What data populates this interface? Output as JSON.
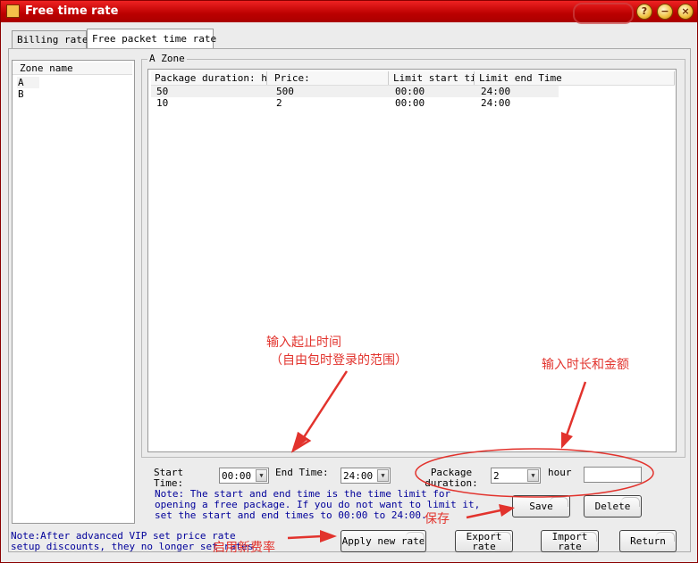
{
  "window": {
    "title": "Free time rate",
    "buttons": {
      "help": "?",
      "minimize": "−",
      "close": "×"
    }
  },
  "tabs": [
    {
      "label": "Billing rate",
      "active": false
    },
    {
      "label": "Free packet time rate",
      "active": true
    }
  ],
  "zone_list": {
    "header": "Zone name",
    "items": [
      "A",
      "B"
    ],
    "selected": "A"
  },
  "group": {
    "label": "A Zone"
  },
  "table": {
    "columns": [
      "Package duration: hour",
      "Price:",
      "Limit start time",
      "Limit end Time"
    ],
    "rows": [
      [
        "50",
        "500",
        "00:00",
        "24:00"
      ],
      [
        "10",
        "2",
        "00:00",
        "24:00"
      ]
    ]
  },
  "form": {
    "start_time_label": "Start Time:",
    "start_time_value": "00:00",
    "end_time_label": "End Time:",
    "end_time_value": "24:00",
    "package_duration_label": "Package duration:",
    "package_duration_value": "2",
    "hour_label": "hour",
    "price_value": ""
  },
  "note_time": "Note: The start and end time is the time limit for opening a free package. If you do not want to limit it, set the start and end times to 00:00 to 24:00.",
  "note_vip": "Note:After advanced VIP set price rate setup discounts, they no longer set rates.",
  "buttons": {
    "save": "Save",
    "delete": "Delete",
    "apply": "Apply new rate",
    "export": "Export rate",
    "import": "Import rate",
    "return": "Return"
  },
  "annotations": {
    "time_range": "输入起止时间",
    "time_range_sub": "（自由包时登录的范围）",
    "duration_amount": "输入时长和金额",
    "save": "保存",
    "apply": "启用新费率"
  },
  "colors": {
    "titlebar": "#c40000",
    "note_text": "#00009a",
    "annotation": "#e2332d"
  }
}
